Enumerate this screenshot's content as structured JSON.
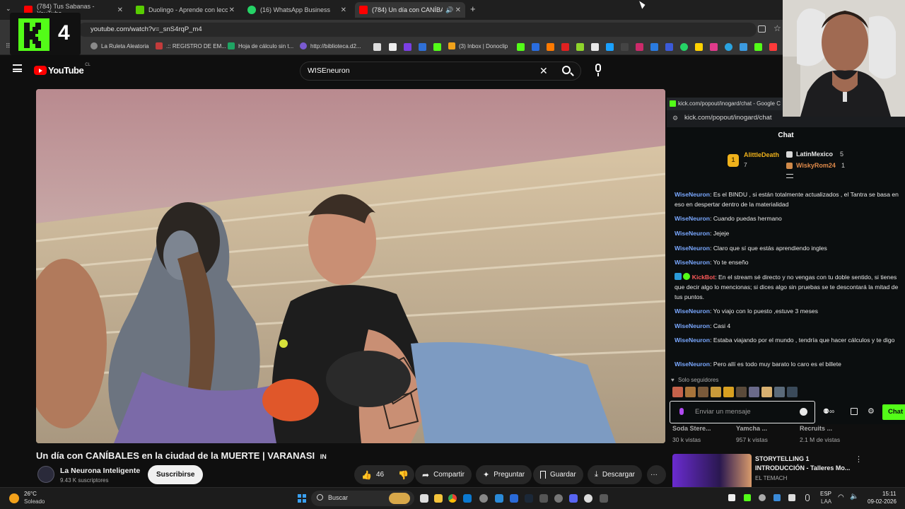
{
  "browser": {
    "tabs": [
      {
        "label": "(784) Tus Sabanas - YouTube",
        "color": "#ff0000"
      },
      {
        "label": "Duolingo - Aprende con leccio",
        "color": "#58cc02"
      },
      {
        "label": "(16) WhatsApp Business",
        "color": "#25d366"
      },
      {
        "label": "(784) Un día con CANÍBALE",
        "color": "#ff0000"
      }
    ],
    "new_tab": "+",
    "url": "youtube.com/watch?v=_snS4rqP_m4",
    "bookmarks": [
      "La Ruleta Aleatoria",
      ".:: REGISTRO DE EM...",
      "Hoja de cálculo sin t...",
      "http://biblioteca.d2...",
      "(3) Inbox | Donoclip"
    ]
  },
  "overlay": {
    "kick_number": "4"
  },
  "youtube": {
    "logo_text": "YouTube",
    "region": "CL",
    "search_value": "WISEneuron",
    "video_title": "Un día con CANÍBALES en la ciudad de la MUERTE | VARANASI",
    "title_suffix": "IN",
    "channel_name": "La Neurona Inteligente",
    "subscribers": "9.43 K suscriptores",
    "subscribe_label": "Suscribirse",
    "likes": "46",
    "share_label": "Compartir",
    "ask_label": "Preguntar",
    "save_label": "Guardar",
    "download_label": "Descargar",
    "more_label": "···"
  },
  "chat": {
    "window_title": "kick.com/popout/inogard/chat - Google C",
    "url": "kick.com/popout/inogard/chat",
    "header": "Chat",
    "leaders": [
      {
        "rank": "1",
        "name": "AlittleDeath",
        "count": "7"
      },
      {
        "name": "LatinMexico",
        "count": "5"
      },
      {
        "name": "WiskyRom24",
        "count": "1"
      }
    ],
    "messages": [
      {
        "user": "WiseNeuron",
        "text": ": Es el BINDU , si están totalmente actualizados , el Tantra se basa en eso en despertar dentro de la materialidad"
      },
      {
        "user": "WiseNeuron",
        "text": ": Cuando puedas hermano"
      },
      {
        "user": "WiseNeuron",
        "text": ": Jejeje"
      },
      {
        "user": "WiseNeuron",
        "text": ": Claro que sí que estás aprendiendo ingles"
      },
      {
        "user": "WiseNeuron",
        "text": ": Yo te enseño"
      },
      {
        "user": "KickBot",
        "text": ": En el stream sé directo y no vengas con tu doble sentido, si tienes que decir algo lo mencionas; si dices algo sin pruebas se te descontará la mitad de tus puntos."
      },
      {
        "user": "WiseNeuron",
        "text": ": Yo viajo con lo puesto ,estuve 3 meses"
      },
      {
        "user": "WiseNeuron",
        "text": ": Casi 4"
      },
      {
        "user": "WiseNeuron",
        "text": ": Estaba viajando por el mundo , tendría que hacer cálculos y te digo"
      },
      {
        "user": "WiseNeuron",
        "text": ": Pero allí es todo muy barato lo caro es el billete"
      }
    ],
    "followers_only": "Solo seguidores",
    "input_placeholder": "Enviar un mensaje",
    "send_label": "Chat"
  },
  "recs": {
    "items": [
      {
        "title": "Soda Stere...",
        "views": "30 k vistas"
      },
      {
        "title": "Yamcha ...",
        "views": "957 k vistas"
      },
      {
        "title": "Recruits ...",
        "views": "2.1 M de vistas"
      }
    ],
    "featured_title_1": "STORYTELLING 1",
    "featured_title_2": "INTRODUCCIÓN - Talleres Mo...",
    "featured_channel": "EL TEMACH"
  },
  "taskbar": {
    "temperature": "26°C",
    "weather": "Soleado",
    "search_label": "Buscar",
    "lang": "ESP",
    "lang_sub": "LAA",
    "time": "15:11",
    "date": "09-02-2026"
  },
  "colors": {
    "kick_green": "#53fc18",
    "yt_red": "#ff0000",
    "chat_user": "#7aa8ff"
  }
}
